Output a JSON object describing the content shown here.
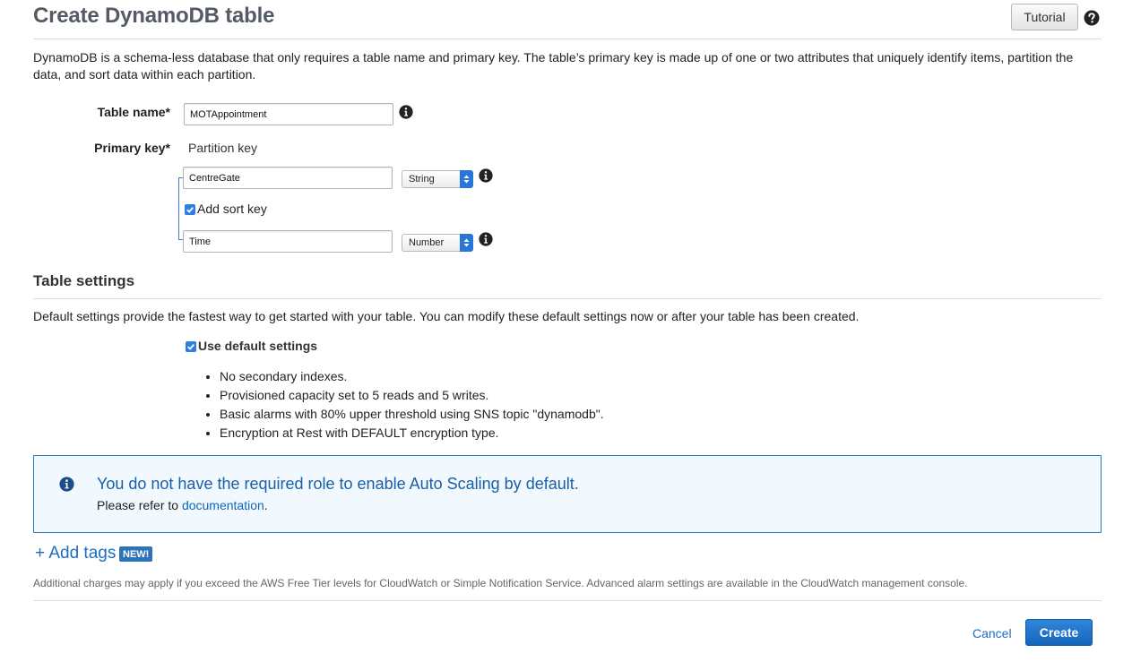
{
  "header": {
    "title": "Create DynamoDB table",
    "tutorial_label": "Tutorial"
  },
  "intro": {
    "description": "DynamoDB is a schema-less database that only requires a table name and primary key. The table’s primary key is made up of one or two attributes that uniquely identify items, partition the data, and sort data within each partition."
  },
  "form": {
    "table_name_label": "Table name*",
    "table_name_value": "MOTAppointment",
    "primary_key_label": "Primary key*",
    "partition_key_label": "Partition key",
    "partition_key_value": "CentreGate",
    "partition_key_type": "String",
    "add_sort_key_label": "Add sort key",
    "add_sort_key_checked": true,
    "sort_key_value": "Time",
    "sort_key_type": "Number"
  },
  "table_settings": {
    "title": "Table settings",
    "description": "Default settings provide the fastest way to get started with your table. You can modify these default settings now or after your table has been created.",
    "use_default_label": "Use default settings",
    "use_default_checked": true,
    "defaults": [
      "No secondary indexes.",
      "Provisioned capacity set to 5 reads and 5 writes.",
      "Basic alarms with 80% upper threshold using SNS topic \"dynamodb\".",
      "Encryption at Rest with DEFAULT encryption type."
    ]
  },
  "alert": {
    "title": "You do not have the required role to enable Auto Scaling by default.",
    "text_prefix": "Please refer to",
    "link_label": "documentation",
    "text_suffix": "."
  },
  "tags": {
    "add_label": "+ Add tags",
    "badge": "NEW!"
  },
  "footer": {
    "fine_print": "Additional charges may apply if you exceed the AWS Free Tier levels for CloudWatch or Simple Notification Service. Advanced alarm settings are available in the CloudWatch management console.",
    "cancel_label": "Cancel",
    "create_label": "Create"
  },
  "colors": {
    "primary": "#1566bb",
    "link": "#1a6fc2",
    "alert_border": "#2a78b5",
    "alert_bg": "#f1f9ff"
  }
}
